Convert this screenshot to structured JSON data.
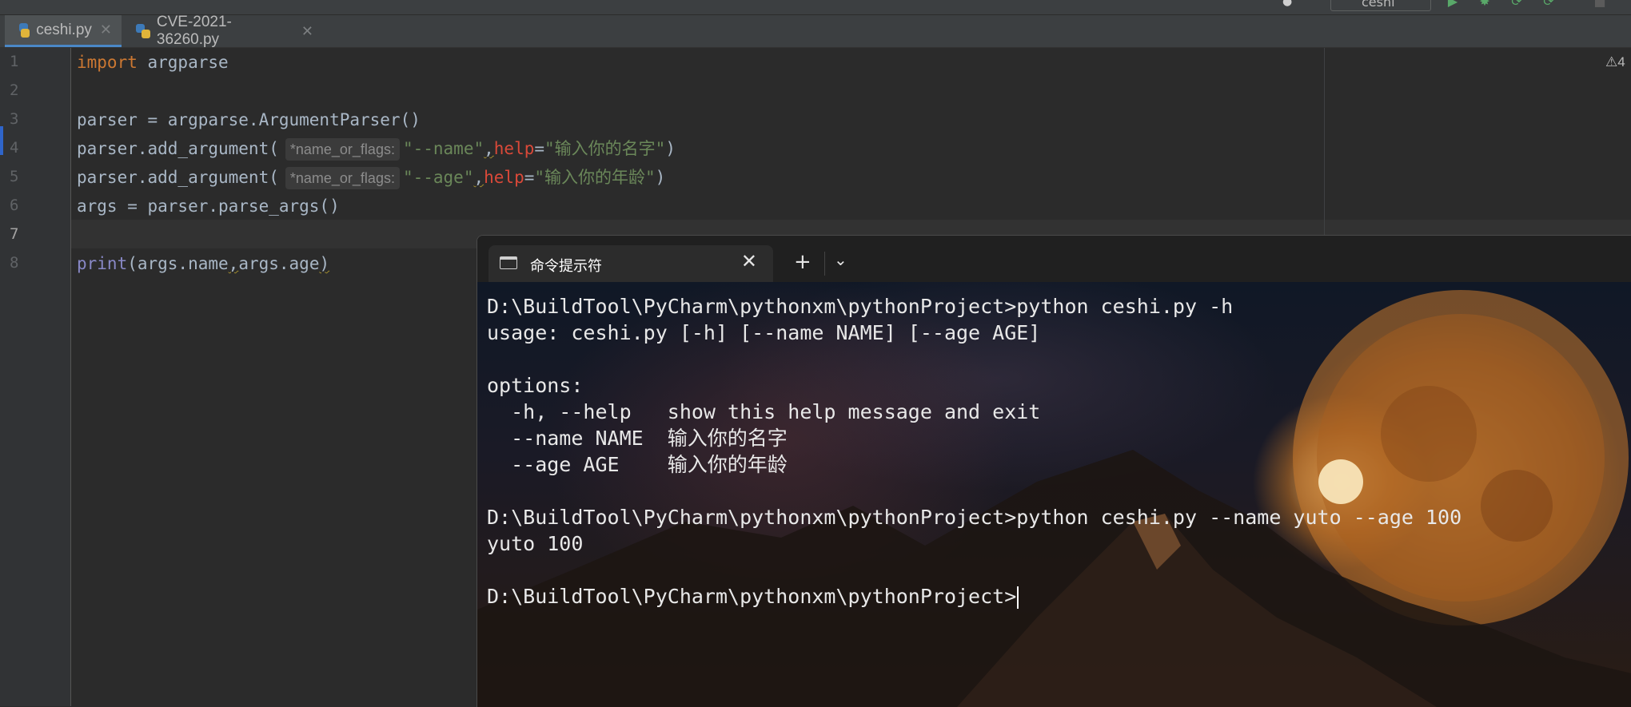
{
  "toolbar": {
    "run_config_label": "ceshi",
    "accent_run": "#59a869",
    "accent_debug": "#59a869"
  },
  "tabs": [
    {
      "label": "ceshi.py",
      "active": true
    },
    {
      "label": "CVE-2021-36260.py",
      "active": false
    }
  ],
  "editor": {
    "line_numbers": [
      "1",
      "2",
      "3",
      "4",
      "5",
      "6",
      "7",
      "8"
    ],
    "warnings_count": "4",
    "lines": {
      "l1_kw": "import",
      "l1_rest": " argparse",
      "l3": "parser = argparse.ArgumentParser()",
      "l4_a": "parser.add_argument(",
      "l4_hint": "*name_or_flags:",
      "l4_str1": "\"--name\"",
      "l4_comma": ",",
      "l4_param": "help",
      "l4_eq": "=",
      "l4_str2": "\"输入你的名字\"",
      "l4_close": ")",
      "l5_a": "parser.add_argument(",
      "l5_hint": "*name_or_flags:",
      "l5_str1": "\"--age\"",
      "l5_comma": ",",
      "l5_param": "help",
      "l5_eq": "=",
      "l5_str2": "\"输入你的年龄\"",
      "l5_close": ")",
      "l6": "args = parser.parse_args()",
      "l8_fn": "print",
      "l8_a": "(args.name",
      "l8_comma": ",",
      "l8_b": "args.age",
      "l8_close": ")"
    }
  },
  "terminal": {
    "title": "命令提示符",
    "new_tab": "+",
    "lines": [
      "D:\\BuildTool\\PyCharm\\pythonxm\\pythonProject>python ceshi.py -h",
      "usage: ceshi.py [-h] [--name NAME] [--age AGE]",
      "",
      "options:",
      "  -h, --help   show this help message and exit",
      "  --name NAME  输入你的名字",
      "  --age AGE    输入你的年龄",
      "",
      "D:\\BuildTool\\PyCharm\\pythonxm\\pythonProject>python ceshi.py --name yuto --age 100",
      "yuto 100",
      "",
      "D:\\BuildTool\\PyCharm\\pythonxm\\pythonProject>"
    ]
  }
}
